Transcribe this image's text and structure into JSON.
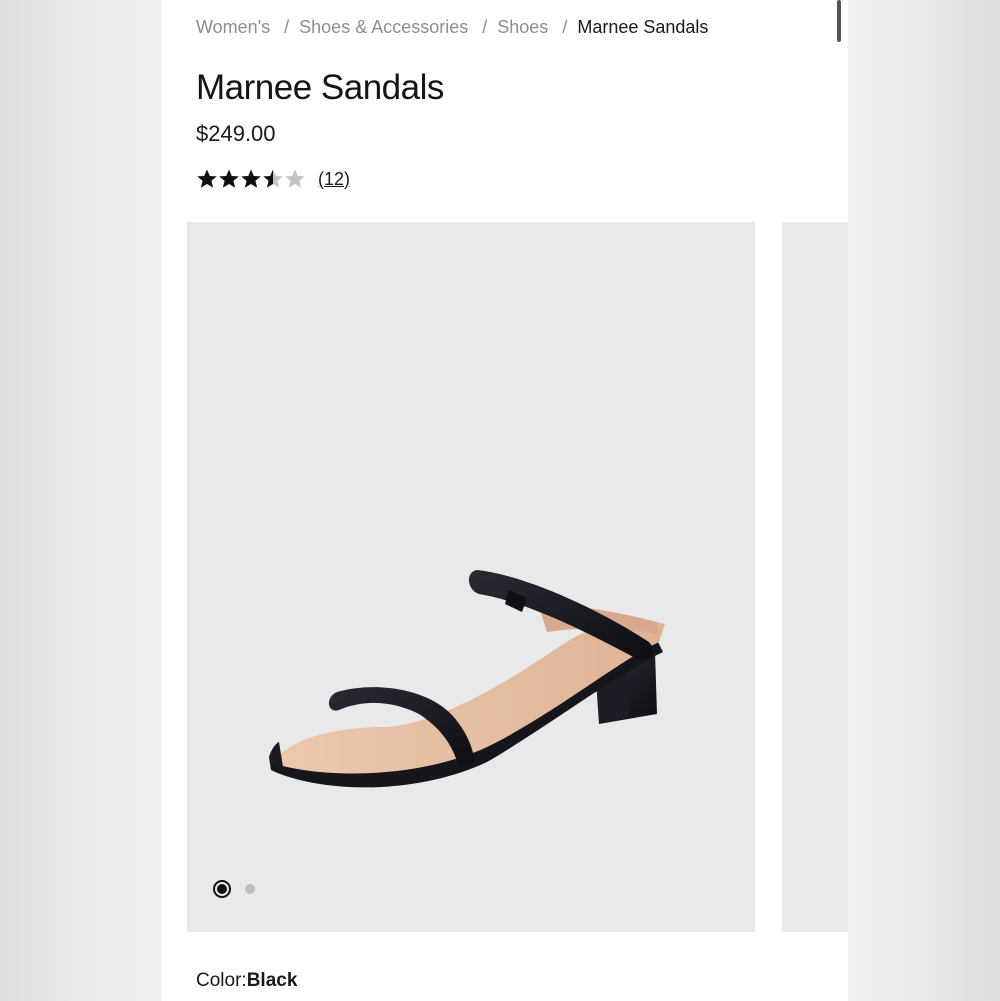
{
  "breadcrumb": {
    "items": [
      "Women's",
      "Shoes & Accessories",
      "Shoes"
    ],
    "current": "Marnee Sandals",
    "separator": "/"
  },
  "product": {
    "title": "Marnee Sandals",
    "price": "$249.00",
    "rating": 3.5,
    "rating_max": 5,
    "review_count": "(12)"
  },
  "gallery": {
    "image_count": 2,
    "active_index": 0
  },
  "color": {
    "label": "Color:",
    "value": "Black"
  },
  "colors": {
    "text": "#1a1a1a",
    "muted": "#8d8d8d",
    "gallery_bg": "#e9e9eb",
    "star_filled": "#111111",
    "star_empty": "#c4c4c4"
  },
  "icons": {
    "star": "star-icon",
    "half_star": "half-star-icon"
  }
}
